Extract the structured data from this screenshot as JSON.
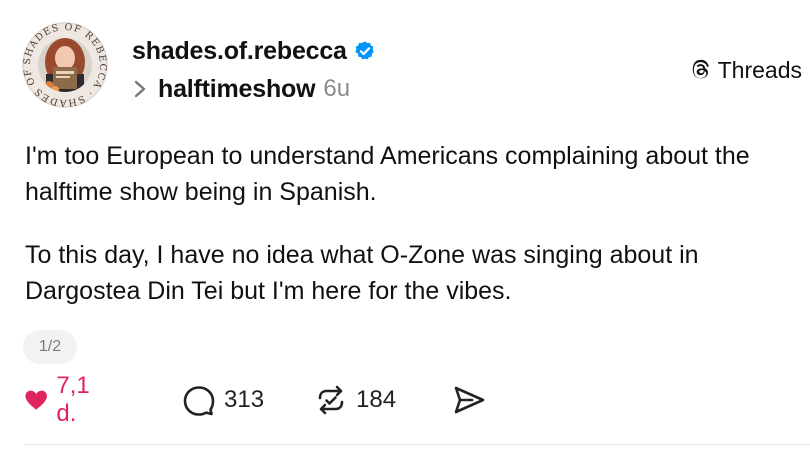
{
  "author": {
    "username": "shades.of.rebecca",
    "avatar_ring_text": "SHADES OF REBECCA · SHADES OF REBECCA ·",
    "verified": true
  },
  "topic": {
    "name": "halftimeshow",
    "time": "6u"
  },
  "brand": {
    "name": "Threads",
    "icon": "threads-logo-icon"
  },
  "post": {
    "paragraphs": [
      "I'm too European to understand Americans complaining about the halftime show being in Spanish.",
      "To this day, I have no idea what O-Zone was singing about in Dargostea Din Tei but I'm here for the vibes."
    ],
    "pager": "1/2"
  },
  "actions": {
    "likes": "7,1 d.",
    "replies": "313",
    "reposts": "184"
  },
  "colors": {
    "like_red": "#e0245e",
    "verified_blue": "#0095f6",
    "muted_gray": "#8b8b8b"
  }
}
